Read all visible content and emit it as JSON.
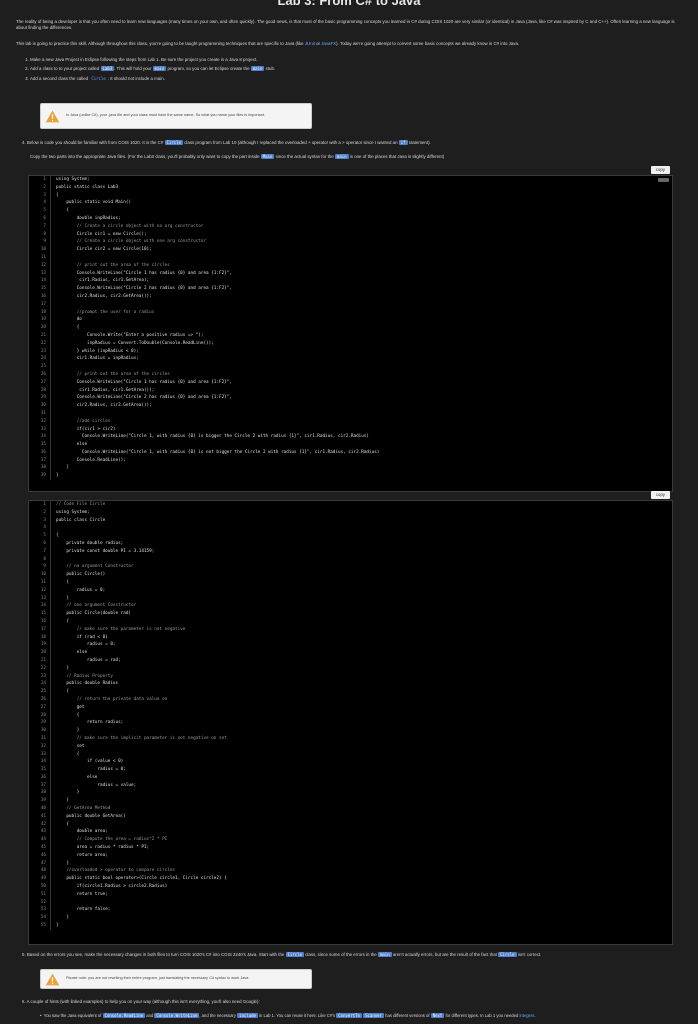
{
  "page": {
    "title": "Lab 3: From C# to Java",
    "intro_p1": "The reality of being a developer is that you often need to learn new languages (many times on your own, and often quickly). The good news, is that most of the basic programming concepts you learned in C# during COIS 1020 are very similar (or identical) in Java (Java, like C# was inspired by C and C++). Often learning a new language is about finding the differences.",
    "intro_p2_a": "This lab is going to practice this skill. Although throughout this class, you're going to be taught programming techniques that are specific to Java (like ",
    "intro_p2_link1": "JUnit",
    "intro_p2_or": " or ",
    "intro_p2_link2": "JavaFX",
    "intro_p2_b": "). Today we're going attempt to convert some basic concepts we already know in C# into Java.",
    "steps": [
      {
        "a": "Make a new Java Project in Eclipse following the steps from Lab 1. Be sure the project you create is a Java 8 project."
      },
      {
        "a": "Add a class to to your project called ",
        "code": "Lab3",
        "b": ". This will hold your ",
        "code2": "main",
        "c": " program, so you can let Eclipse create the ",
        "code3": "main",
        "d": " stub."
      },
      {
        "a": "Add a second class the called ",
        "code": "Circle",
        "b": ". It should not include a main."
      }
    ],
    "note1": "In Java (unlike C#), your .java file and your class must have the same name. So what you name your files is important.",
    "step4_a": "4.  Below is code you should be familiar with from COIS 1020. It is the C# ",
    "step4_code1": "Circle",
    "step4_b": " class program from Lab 10 (although I replaced the overloaded + operator with a > operator since I wanted an ",
    "step4_code2": "if",
    "step4_c": " statement).",
    "copy_a": "Copy the two parts into the appropriate Java files. (For the Lab3 class, you'll probably only want to copy the part inside ",
    "copy_code1": "Main",
    "copy_b": " since the actual syntax for the ",
    "copy_code2": "main",
    "copy_c": " is one of the places that Java is slightly different)",
    "copy_label": "copy",
    "code1": [
      "using System;",
      "public static class Lab3",
      "{",
      "    public static void Main()",
      "    {",
      "        double inpRadius;",
      "        // Create a circle object with no arg constructor",
      "        Circle cir1 = new Circle();",
      "        // Create a circle object with one arg constructor",
      "        Circle cir2 = new Circle(10);",
      "",
      "        // print out the area of the circles",
      "        Console.WriteLine(\"Circle 1 has radius {0} and area {1:F2}\",",
      "         cir1.Radius, cir1.GetArea);",
      "        Console.WriteLine(\"Circle 2 has radius {0} and area {1:F2}\",",
      "        cir2.Radius, cir2.GetArea());",
      "",
      "        //prompt the user for a radius",
      "        do",
      "        {",
      "            Console.Write(\"Enter a positive radius => \");",
      "            inpRadius = Convert.ToDouble(Console.ReadLine());",
      "        } while (inpRadius < 0);",
      "        cir1.Radius = inpRadius;",
      "",
      "        // print out the area of the circles",
      "        Console.WriteLine(\"Circle 1 has radius {0} and area {1:F2}\",",
      "         cir1.Radius, cir1.GetArea());",
      "        Console.WriteLine(\"Circle 2 has radius {0} and area {1:F2}\",",
      "        cir2.Radius, cir2.GetArea());",
      "",
      "        //add circles",
      "        if(cir1 > cir2)",
      "          Console.WriteLine(\"Circle 1, with radius {0} is bigger the Circle 2 with radius {1}\", cir1.Radius, cir2.Radius)",
      "        else",
      "          Console.WriteLine(\"Circle 1, with radius {0} is not bigger the Circle 2 with radius {1}\", cir1.Radius, cir2.Radius)",
      "        Console.ReadLine();",
      "    }",
      "}"
    ],
    "code2": [
      "// Code File Circle",
      "using System;",
      "public class Circle",
      "",
      "{",
      "    private double radius;",
      "    private const double PI = 3.14159;",
      "",
      "    // no argument Constructor",
      "    public Circle()",
      "    {",
      "        radius = 0;",
      "    }",
      "    // one argument Constructor",
      "    public Circle(double rad)",
      "    {",
      "        // make sure the parameter is not negative",
      "        if (rad < 0)",
      "            radius = 0;",
      "        else",
      "            radius = rad;",
      "    }",
      "    // Radius Property",
      "    public double Radius",
      "    {",
      "        // return the private data value on",
      "        get",
      "        {",
      "            return radius;",
      "        }",
      "        // make sure the implicit parameter is not negative on set",
      "        set",
      "        {",
      "            if (value < 0)",
      "                radius = 0;",
      "            else",
      "                radius = value;",
      "        }",
      "    }",
      "    // GetArea Method",
      "    public double GetArea()",
      "    {",
      "        double area;",
      "        // Compute the area = radius^2 * PI",
      "        area = radius * radius * PI;",
      "        return area;",
      "    }",
      "    //overloaded > operator to compare circles",
      "    public static bool operator>(Circle circle1, Circle circle2) {",
      "        if(circle1.Radius > circle2.Radius)",
      "        return true;",
      "",
      "        return false;",
      "    }",
      "}"
    ],
    "step5_a": "5.  Based on the errors you see, make the necessary changes in both files to turn COIS 1020's C# into COIS 2240's Java. Start with the ",
    "step5_code1": "Circle",
    "step5_b": " class, since some of the errors in the ",
    "step5_code2": "main",
    "step5_c": " aren't actually errors, but are the result of the fact that ",
    "step5_code3": "Circle",
    "step5_d": " isn't correct.",
    "note2": "Please note: you are not rewriting their entire program, just translating the necessary C# syntax to work Java",
    "step6": "6.  A couple of hints (with linked examples) to help you on your way (although this isn't everything, you'll also need Google):",
    "hint_a": "You saw the Java equivalent of ",
    "hint_code1": "Console.ReadLine",
    "hint_and": " and ",
    "hint_code2": "Console.WriteLine",
    "hint_b": ", and the necessary ",
    "hint_code3": "include",
    "hint_c": " in Lab 1. You can reuse it here. Like C#'s ",
    "hint_code4": "ConvertTo",
    "hint_d": " ",
    "hint_code5": "Scanner",
    "hint_e": " has different versions of ",
    "hint_code6": "Next",
    "hint_f": " for different types. In Lab 1 you needed ",
    "hint_link": "integers",
    "hint_g": "."
  }
}
